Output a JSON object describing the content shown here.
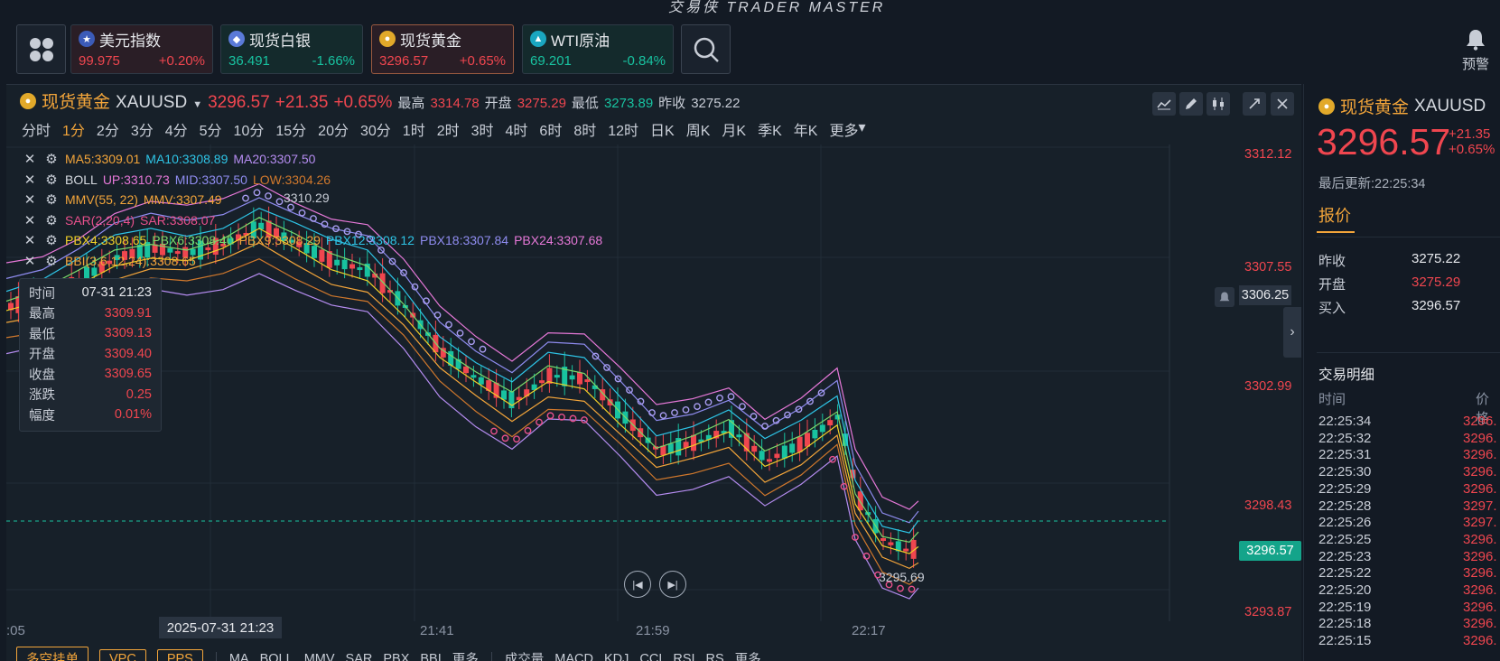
{
  "app": {
    "title": "交易侠 TRADER MASTER"
  },
  "tickers": [
    {
      "name": "美元指数",
      "price": "99.975",
      "change": "+0.20%",
      "icon": "us-flag-icon",
      "dir": "up"
    },
    {
      "name": "现货白银",
      "price": "36.491",
      "change": "-1.66%",
      "icon": "silver-coin-icon",
      "dir": "down"
    },
    {
      "name": "现货黄金",
      "price": "3296.57",
      "change": "+0.65%",
      "icon": "gold-coin-icon",
      "dir": "up"
    },
    {
      "name": "WTI原油",
      "price": "69.201",
      "change": "-0.84%",
      "icon": "oil-icon",
      "dir": "down"
    }
  ],
  "alert": {
    "label": "预警"
  },
  "symbol": {
    "name": "现货黄金",
    "code": "XAUUSD",
    "price": "3296.57",
    "change": "+21.35",
    "pct": "+0.65%",
    "high_label": "最高",
    "high": "3314.78",
    "open_label": "开盘",
    "open": "3275.29",
    "low_label": "最低",
    "low": "3273.89",
    "prev_label": "昨收",
    "prev": "3275.22"
  },
  "timeframes": [
    "分时",
    "1分",
    "2分",
    "3分",
    "4分",
    "5分",
    "10分",
    "15分",
    "20分",
    "30分",
    "1时",
    "2时",
    "3时",
    "4时",
    "6时",
    "8时",
    "12时",
    "日K",
    "周K",
    "月K",
    "季K",
    "年K",
    "更多"
  ],
  "active_timeframe": "1分",
  "indicators": [
    {
      "parts": [
        {
          "t": "MA5:3309.01",
          "c": "#f3a53a"
        },
        {
          "t": "MA10:3308.89",
          "c": "#2ec4e6"
        },
        {
          "t": "MA20:3307.50",
          "c": "#b58cf0"
        }
      ]
    },
    {
      "parts": [
        {
          "t": "BOLL",
          "c": "#d6dae0"
        },
        {
          "t": "UP:3310.73",
          "c": "#e678d8"
        },
        {
          "t": "MID:3307.50",
          "c": "#8f8cf0"
        },
        {
          "t": "LOW:3304.26",
          "c": "#d0782c"
        }
      ]
    },
    {
      "parts": [
        {
          "t": "MMV(55, 22)",
          "c": "#f3a53a"
        },
        {
          "t": "MMV:3307.49",
          "c": "#f3a53a"
        }
      ]
    },
    {
      "parts": [
        {
          "t": "SAR(2,20,4)",
          "c": "#e8508c"
        },
        {
          "t": "SAR:3308.07",
          "c": "#e8508c"
        }
      ]
    },
    {
      "parts": [
        {
          "t": "PBX4:3308.65",
          "c": "#f0d028"
        },
        {
          "t": "PBX6:3308.40",
          "c": "#7ad96a"
        },
        {
          "t": "PBX9:3308.29",
          "c": "#f3a53a"
        },
        {
          "t": "PBX12:3308.12",
          "c": "#2ec4e6"
        },
        {
          "t": "PBX18:3307.84",
          "c": "#8f8cf0"
        },
        {
          "t": "PBX24:3307.68",
          "c": "#e678d8"
        }
      ]
    },
    {
      "parts": [
        {
          "t": "BBI(3,6,12,24):3308.65",
          "c": "#f3a53a"
        }
      ]
    }
  ],
  "crosshair": {
    "rows": [
      {
        "k": "时间",
        "v": "07-31 21:23",
        "c": "#e6e8ec"
      },
      {
        "k": "最高",
        "v": "3309.91",
        "c": "#f0464f"
      },
      {
        "k": "最低",
        "v": "3309.13",
        "c": "#f0464f"
      },
      {
        "k": "开盘",
        "v": "3309.40",
        "c": "#f0464f"
      },
      {
        "k": "收盘",
        "v": "3309.65",
        "c": "#f0464f"
      },
      {
        "k": "涨跌",
        "v": "0.25",
        "c": "#f0464f"
      },
      {
        "k": "幅度",
        "v": "0.01%",
        "c": "#f0464f"
      }
    ],
    "price_tag": "3306.25",
    "time_tag": "2025-07-31 21:23"
  },
  "y_axis": [
    "3312.12",
    "3307.55",
    "3302.99",
    "3298.43",
    "3293.87"
  ],
  "x_axis": [
    ":05",
    "21:41",
    "21:59",
    "22:17"
  ],
  "last_price_tag": "3296.57",
  "annotations": {
    "max": "3310.29",
    "min": "3295.69"
  },
  "bottom": {
    "buttons": [
      "多空挂单",
      "VPC",
      "PPS"
    ],
    "main_indicators": [
      "MA",
      "BOLL",
      "MMV",
      "SAR",
      "PBX",
      "BBI",
      "更多"
    ],
    "sub_indicators": [
      "成交量",
      "MACD",
      "KDJ",
      "CCI",
      "RSI",
      "RS",
      "更多"
    ]
  },
  "right_panel": {
    "name": "现货黄金",
    "code": "XAUUSD",
    "price": "3296.57",
    "change": "+21.35",
    "pct": "+0.65%",
    "updated": "最后更新:22:25:34",
    "tab": "报价",
    "quotes": [
      {
        "k": "昨收",
        "v": "3275.22",
        "c": "#e6e8ec"
      },
      {
        "k": "开盘",
        "v": "3275.29",
        "c": "#f0464f"
      },
      {
        "k": "买入",
        "v": "3296.57",
        "c": "#e6e8ec"
      }
    ],
    "trades_title": "交易明细",
    "trades_header": {
      "time": "时间",
      "price": "价格"
    },
    "trades": [
      {
        "t": "22:25:34",
        "p": "3296."
      },
      {
        "t": "22:25:32",
        "p": "3296."
      },
      {
        "t": "22:25:31",
        "p": "3296."
      },
      {
        "t": "22:25:30",
        "p": "3296."
      },
      {
        "t": "22:25:29",
        "p": "3296."
      },
      {
        "t": "22:25:28",
        "p": "3297."
      },
      {
        "t": "22:25:26",
        "p": "3297."
      },
      {
        "t": "22:25:25",
        "p": "3296."
      },
      {
        "t": "22:25:23",
        "p": "3296."
      },
      {
        "t": "22:25:22",
        "p": "3296."
      },
      {
        "t": "22:25:20",
        "p": "3296."
      },
      {
        "t": "22:25:19",
        "p": "3296."
      },
      {
        "t": "22:25:18",
        "p": "3296."
      },
      {
        "t": "22:25:15",
        "p": "3296."
      }
    ]
  },
  "colors": {
    "up": "#f0464f",
    "down": "#18c2a0",
    "accent": "#f3a53a",
    "background": "#172029"
  }
}
